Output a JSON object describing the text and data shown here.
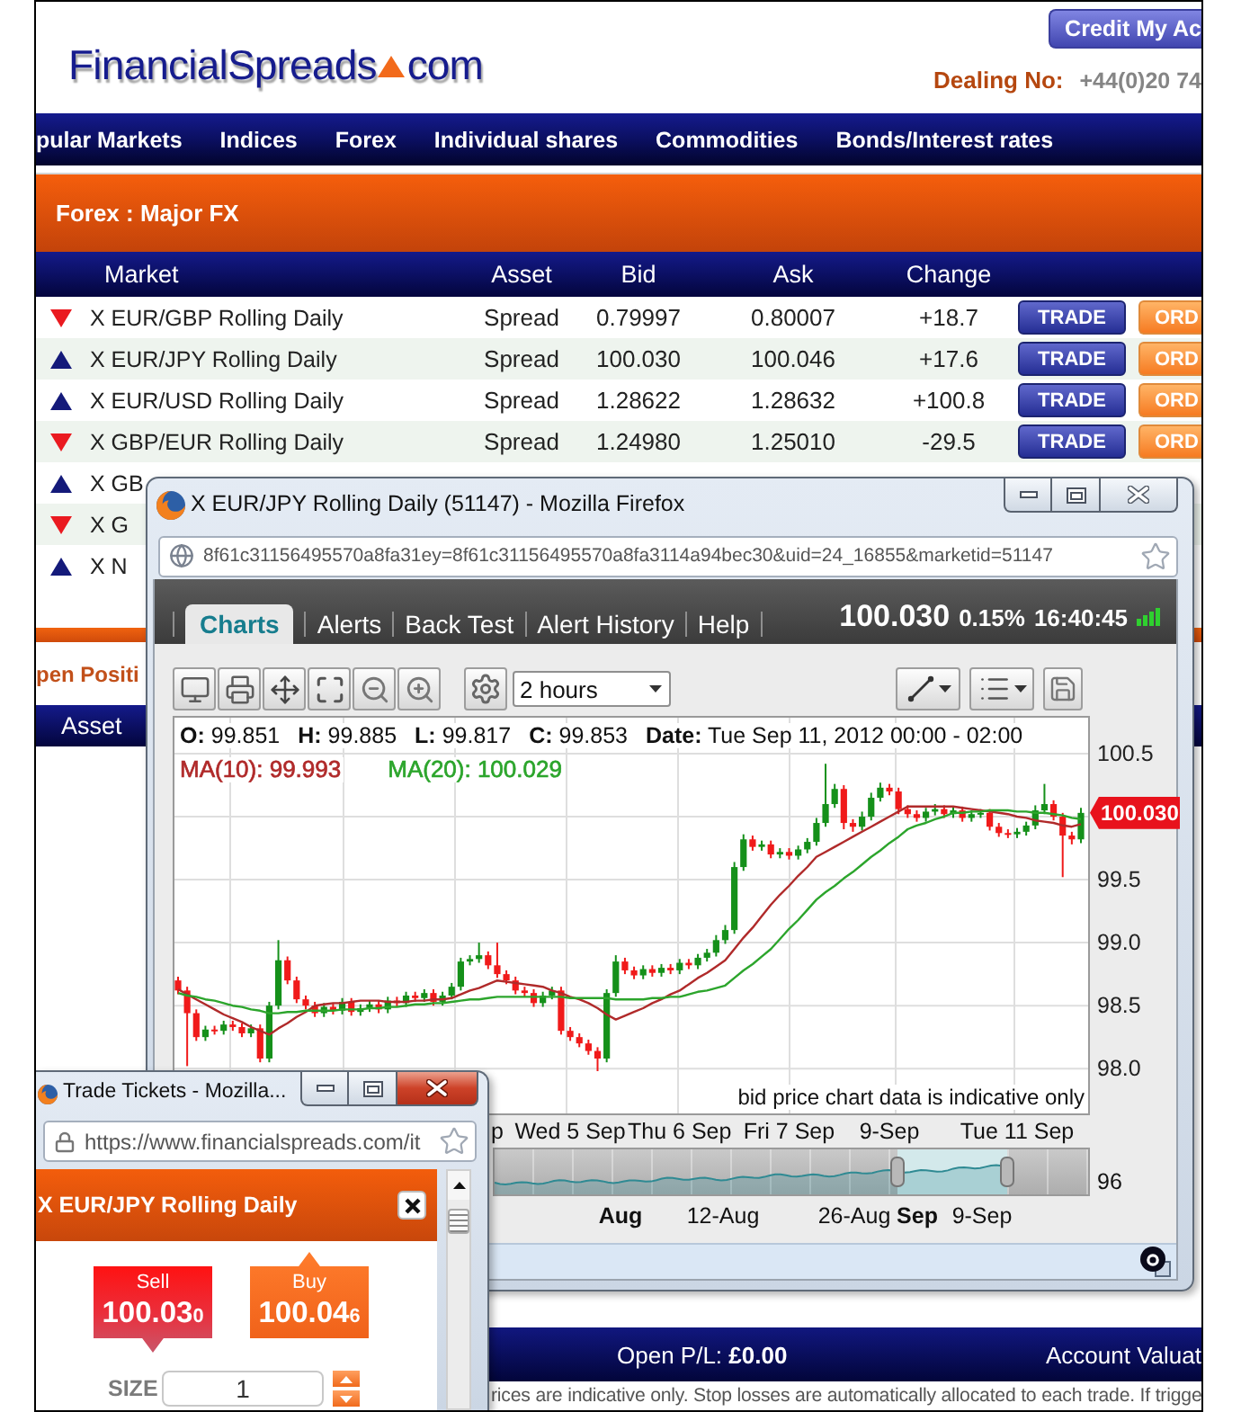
{
  "site": {
    "logo": {
      "name": "FinancialSpreads",
      "suffix": "com"
    },
    "account_button": "Credit My Ac",
    "dealing_label": "Dealing No:",
    "dealing_number": "+44(0)20 74"
  },
  "nav": [
    "pular Markets",
    "Indices",
    "Forex",
    "Individual shares",
    "Commodities",
    "Bonds/Interest rates"
  ],
  "section_title": "Forex : Major FX",
  "markets": {
    "columns": [
      "Market",
      "Asset",
      "Bid",
      "Ask",
      "Change"
    ],
    "rows": [
      {
        "rising": false,
        "market": "X EUR/GBP Rolling Daily",
        "asset": "Spread",
        "bid": "0.79997",
        "ask": "0.80007",
        "change": "+18.7",
        "trade": "TRADE",
        "order": "ORD"
      },
      {
        "rising": true,
        "market": "X EUR/JPY Rolling Daily",
        "asset": "Spread",
        "bid": "100.030",
        "ask": "100.046",
        "change": "+17.6",
        "trade": "TRADE",
        "order": "ORD"
      },
      {
        "rising": true,
        "market": "X EUR/USD Rolling Daily",
        "asset": "Spread",
        "bid": "1.28622",
        "ask": "1.28632",
        "change": "+100.8",
        "trade": "TRADE",
        "order": "ORD"
      },
      {
        "rising": false,
        "market": "X GBP/EUR Rolling Daily",
        "asset": "Spread",
        "bid": "1.24980",
        "ask": "1.25010",
        "change": "-29.5",
        "trade": "TRADE",
        "order": "ORD"
      },
      {
        "rising": true,
        "market": "X GB"
      },
      {
        "rising": false,
        "market": "X G"
      },
      {
        "rising": true,
        "market": "X N"
      }
    ]
  },
  "positions": {
    "title": "pen Positi",
    "columns": [
      "Asset"
    ]
  },
  "account_bar": {
    "open_pl": "Open P/L: **£0.00**",
    "valuation": "Account Valuat"
  },
  "disclaimer": "rices are indicative only. Stop losses are automatically allocated to each trade. If trigge",
  "chart_window": {
    "active": false,
    "title": "X EUR/JPY Rolling Daily (51147) - Mozilla Firefox",
    "url": "8f61c31156495570a8fa31ey=8f61c31156495570a8fa3114a94bec30&uid=24_16855&marketid=51147",
    "tabs": [
      {
        "label": "Charts",
        "selected": true
      },
      {
        "label": "Alerts",
        "selected": false
      },
      {
        "label": "Back Test",
        "selected": false
      },
      {
        "label": "Alert History",
        "selected": false
      },
      {
        "label": "Help",
        "selected": false
      }
    ],
    "quote": {
      "price": "100.030",
      "change": "0.15%",
      "time": "16:40:45"
    },
    "interval": "2 hours",
    "readouts": [
      "**O:** 99.851",
      "**H:** 99.885",
      "**L:** 99.817",
      "**C:** 99.853",
      "**Date:** Tue Sep 11, 2012 00:00 - 02:00"
    ],
    "chart_data": {
      "type": "candlestick",
      "grid": true,
      "categories": [
        null,
        null,
        null,
        null,
        null,
        null,
        null,
        null,
        null,
        null,
        null,
        null,
        null,
        null,
        null,
        null,
        null,
        null,
        null,
        null,
        null,
        null,
        null,
        null,
        null,
        null,
        null,
        null,
        null,
        null,
        null,
        null,
        null,
        null,
        null,
        "p",
        null,
        null,
        null,
        null,
        null,
        null,
        null,
        "Wed 5 Sep",
        null,
        null,
        null,
        null,
        null,
        null,
        null,
        null,
        null,
        null,
        null,
        "Thu 6 Sep",
        null,
        null,
        null,
        null,
        null,
        null,
        null,
        null,
        null,
        null,
        null,
        "Fri 7 Sep",
        null,
        null,
        null,
        null,
        null,
        null,
        null,
        null,
        null,
        null,
        "9-Sep",
        null,
        null,
        null,
        null,
        null,
        null,
        null,
        null,
        null,
        null,
        null,
        null,
        null,
        "Tue 11 Sep",
        null,
        null,
        null,
        null,
        null,
        null,
        null
      ],
      "ohlc": [
        [
          98.7,
          98.73,
          98.59,
          98.62
        ],
        [
          98.62,
          98.65,
          98.02,
          98.44
        ],
        [
          98.44,
          98.47,
          98.22,
          98.25
        ],
        [
          98.25,
          98.34,
          98.22,
          98.31
        ],
        [
          98.31,
          98.34,
          98.27,
          98.3
        ],
        [
          98.3,
          98.38,
          98.27,
          98.35
        ],
        [
          98.35,
          98.38,
          98.3,
          98.33
        ],
        [
          98.33,
          98.36,
          98.25,
          98.28
        ],
        [
          98.28,
          98.35,
          98.25,
          98.32
        ],
        [
          98.32,
          98.35,
          98.05,
          98.08
        ],
        [
          98.08,
          98.53,
          98.05,
          98.5
        ],
        [
          98.5,
          99.02,
          98.47,
          98.86
        ],
        [
          98.86,
          98.89,
          98.67,
          98.7
        ],
        [
          98.7,
          98.73,
          98.52,
          98.55
        ],
        [
          98.55,
          98.58,
          98.47,
          98.5
        ],
        [
          98.5,
          98.53,
          98.41,
          98.44
        ],
        [
          98.44,
          98.52,
          98.41,
          98.49
        ],
        [
          98.49,
          98.52,
          98.43,
          98.46
        ],
        [
          98.46,
          98.56,
          98.43,
          98.53
        ],
        [
          98.53,
          98.56,
          98.42,
          98.45
        ],
        [
          98.45,
          98.51,
          98.42,
          98.48
        ],
        [
          98.48,
          98.54,
          98.45,
          98.51
        ],
        [
          98.51,
          98.54,
          98.44,
          98.47
        ],
        [
          98.47,
          98.57,
          98.44,
          98.54
        ],
        [
          98.54,
          98.57,
          98.49,
          98.52
        ],
        [
          98.52,
          98.61,
          98.49,
          98.58
        ],
        [
          98.58,
          98.61,
          98.53,
          98.56
        ],
        [
          98.56,
          98.63,
          98.53,
          98.6
        ],
        [
          98.6,
          98.63,
          98.5,
          98.53
        ],
        [
          98.53,
          98.61,
          98.5,
          98.58
        ],
        [
          98.58,
          98.68,
          98.55,
          98.65
        ],
        [
          98.65,
          98.88,
          98.62,
          98.85
        ],
        [
          98.85,
          98.9,
          98.82,
          98.87
        ],
        [
          98.87,
          99.0,
          98.84,
          98.9
        ],
        [
          98.9,
          98.93,
          98.79,
          98.82
        ],
        [
          98.82,
          99.0,
          98.72,
          98.75
        ],
        [
          98.75,
          98.78,
          98.67,
          98.7
        ],
        [
          98.7,
          98.73,
          98.59,
          98.62
        ],
        [
          98.62,
          98.65,
          98.57,
          98.6
        ],
        [
          98.6,
          98.63,
          98.49,
          98.52
        ],
        [
          98.52,
          98.61,
          98.49,
          98.58
        ],
        [
          98.58,
          98.65,
          98.55,
          98.62
        ],
        [
          98.62,
          98.65,
          98.27,
          98.3
        ],
        [
          98.3,
          98.33,
          98.22,
          98.25
        ],
        [
          98.25,
          98.28,
          98.17,
          98.2
        ],
        [
          98.2,
          98.23,
          98.11,
          98.14
        ],
        [
          98.14,
          98.17,
          97.98,
          98.08
        ],
        [
          98.08,
          98.63,
          98.05,
          98.6
        ],
        [
          98.6,
          98.9,
          98.57,
          98.85
        ],
        [
          98.85,
          98.88,
          98.75,
          98.78
        ],
        [
          98.78,
          98.81,
          98.71,
          98.74
        ],
        [
          98.74,
          98.82,
          98.71,
          98.79
        ],
        [
          98.79,
          98.82,
          98.73,
          98.76
        ],
        [
          98.76,
          98.83,
          98.73,
          98.8
        ],
        [
          98.8,
          98.83,
          98.75,
          98.78
        ],
        [
          98.78,
          98.87,
          98.75,
          98.84
        ],
        [
          98.84,
          98.87,
          98.79,
          98.82
        ],
        [
          98.82,
          98.91,
          98.79,
          98.88
        ],
        [
          98.88,
          98.95,
          98.85,
          98.92
        ],
        [
          98.92,
          99.06,
          98.89,
          99.02
        ],
        [
          99.02,
          99.14,
          98.99,
          99.1
        ],
        [
          99.1,
          99.64,
          99.07,
          99.6
        ],
        [
          99.6,
          99.86,
          99.57,
          99.82
        ],
        [
          99.82,
          99.85,
          99.73,
          99.76
        ],
        [
          99.76,
          99.81,
          99.73,
          99.78
        ],
        [
          99.78,
          99.81,
          99.67,
          99.7
        ],
        [
          99.7,
          99.75,
          99.67,
          99.72
        ],
        [
          99.72,
          99.75,
          99.66,
          99.69
        ],
        [
          99.69,
          99.77,
          99.66,
          99.74
        ],
        [
          99.74,
          99.83,
          99.71,
          99.8
        ],
        [
          99.8,
          99.99,
          99.77,
          99.95
        ],
        [
          99.95,
          100.42,
          99.92,
          100.1
        ],
        [
          100.1,
          100.26,
          100.07,
          100.22
        ],
        [
          100.22,
          100.25,
          99.9,
          99.95
        ],
        [
          99.95,
          99.98,
          99.88,
          99.92
        ],
        [
          99.92,
          100.04,
          99.89,
          100.0
        ],
        [
          100.0,
          100.19,
          99.97,
          100.15
        ],
        [
          100.15,
          100.27,
          100.12,
          100.23
        ],
        [
          100.23,
          100.26,
          100.17,
          100.2
        ],
        [
          100.2,
          100.23,
          100.02,
          100.06
        ],
        [
          100.06,
          100.09,
          99.99,
          100.02
        ],
        [
          100.02,
          100.05,
          99.96,
          99.99
        ],
        [
          99.99,
          100.07,
          99.96,
          100.04
        ],
        [
          100.04,
          100.1,
          100.01,
          100.06
        ],
        [
          100.06,
          100.09,
          99.99,
          100.02
        ],
        [
          100.02,
          100.08,
          99.99,
          100.05
        ],
        [
          100.05,
          100.08,
          99.96,
          99.99
        ],
        [
          99.99,
          100.05,
          99.96,
          100.02
        ],
        [
          100.02,
          100.06,
          99.99,
          100.03
        ],
        [
          100.03,
          100.06,
          99.89,
          99.92
        ],
        [
          99.92,
          99.95,
          99.84,
          99.87
        ],
        [
          99.87,
          99.9,
          99.83,
          99.86
        ],
        [
          99.86,
          99.91,
          99.83,
          99.88
        ],
        [
          99.88,
          99.96,
          99.85,
          99.93
        ],
        [
          99.93,
          100.09,
          99.9,
          100.05
        ],
        [
          100.05,
          100.26,
          100.02,
          100.1
        ],
        [
          100.1,
          100.13,
          99.97,
          100.0
        ],
        [
          100.0,
          100.03,
          99.52,
          99.85
        ],
        [
          99.85,
          99.88,
          99.78,
          99.82
        ],
        [
          99.82,
          100.07,
          99.79,
          100.03
        ]
      ],
      "ylim": [
        97.63,
        100.8
      ],
      "yticks": [
        {
          "value": 100.5,
          "label": "100.5"
        },
        {
          "value": 99.5,
          "label": "99.5"
        },
        {
          "value": 99,
          "label": "99.0"
        },
        {
          "value": 98.5,
          "label": "98.5"
        },
        {
          "value": 98,
          "label": "98.0"
        }
      ],
      "series": [
        {
          "name": "MA(10): 99.993",
          "type": "line",
          "color": "#b02a2a",
          "values": [
            98.63,
            98.59,
            98.55,
            98.51,
            98.47,
            98.43,
            98.4,
            98.37,
            98.33,
            98.3,
            98.27,
            98.32,
            98.36,
            98.41,
            98.45,
            98.5,
            98.51,
            98.52,
            98.52,
            98.53,
            98.54,
            98.54,
            98.54,
            98.53,
            98.53,
            98.53,
            98.54,
            98.54,
            98.55,
            98.55,
            98.56,
            98.59,
            98.62,
            98.64,
            98.67,
            98.7,
            98.69,
            98.68,
            98.67,
            98.66,
            98.65,
            98.62,
            98.6,
            98.57,
            98.55,
            98.52,
            98.48,
            98.43,
            98.39,
            98.42,
            98.45,
            98.48,
            98.52,
            98.55,
            98.59,
            98.62,
            98.67,
            98.72,
            98.76,
            98.81,
            98.86,
            98.95,
            99.04,
            99.12,
            99.21,
            99.3,
            99.38,
            99.45,
            99.53,
            99.6,
            99.68,
            99.72,
            99.76,
            99.8,
            99.84,
            99.88,
            99.92,
            99.96,
            100.0,
            100.04,
            100.08,
            100.08,
            100.08,
            100.08,
            100.08,
            100.08,
            100.07,
            100.06,
            100.05,
            100.04,
            100.03,
            100.02,
            100.0,
            99.99,
            99.97,
            99.96,
            99.95,
            99.93,
            99.92,
            99.94
          ]
        },
        {
          "name": "MA(20): 100.029",
          "type": "line",
          "color": "#2ca52c",
          "values": [
            98.6,
            98.58,
            98.57,
            98.55,
            98.54,
            98.52,
            98.5,
            98.49,
            98.47,
            98.46,
            98.44,
            98.44,
            98.45,
            98.45,
            98.46,
            98.46,
            98.46,
            98.46,
            98.47,
            98.47,
            98.47,
            98.48,
            98.48,
            98.49,
            98.49,
            98.5,
            98.51,
            98.51,
            98.52,
            98.52,
            98.53,
            98.54,
            98.55,
            98.55,
            98.56,
            98.57,
            98.57,
            98.57,
            98.57,
            98.57,
            98.57,
            98.57,
            98.57,
            98.56,
            98.56,
            98.56,
            98.56,
            98.56,
            98.55,
            98.55,
            98.55,
            98.55,
            98.56,
            98.56,
            98.57,
            98.57,
            98.59,
            98.61,
            98.62,
            98.64,
            98.66,
            98.72,
            98.78,
            98.83,
            98.89,
            98.95,
            99.03,
            99.11,
            99.18,
            99.26,
            99.34,
            99.4,
            99.45,
            99.51,
            99.56,
            99.62,
            99.68,
            99.73,
            99.79,
            99.84,
            99.9,
            99.93,
            99.95,
            99.98,
            100.0,
            100.03,
            100.03,
            100.04,
            100.04,
            100.05,
            100.05,
            100.05,
            100.04,
            100.04,
            100.03,
            100.03,
            100.02,
            100.01,
            99.99,
            99.98
          ]
        }
      ]
    },
    "last_price": "100.030",
    "note": "bid price chart data is indicative only",
    "navigator": {
      "price_label": "96",
      "date_labels": [
        {
          "text": "Aug",
          "kind": "month"
        },
        {
          "text": "12-Aug",
          "kind": "day"
        },
        {
          "text": "26-Aug",
          "kind": "day"
        },
        {
          "text": "Sep",
          "kind": "month"
        },
        {
          "text": "9-Sep",
          "kind": "day"
        }
      ]
    }
  },
  "ticket_window": {
    "active": true,
    "title": "Trade Tickets - Mozilla...",
    "url": "https://www.financialspreads.com/it",
    "market": "X EUR/JPY Rolling Daily",
    "sell": {
      "label": "Sell",
      "price": "100.03$_{0}$"
    },
    "buy": {
      "label": "Buy",
      "price": "100.04$_{6}$"
    },
    "size": {
      "label": "SIZE",
      "value": "1"
    }
  }
}
